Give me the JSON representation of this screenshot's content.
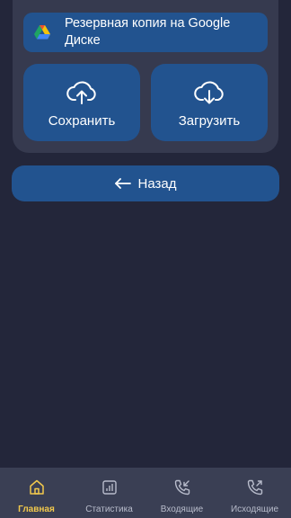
{
  "backup": {
    "drive_label": "Резервная копия на Google Диске",
    "save_label": "Сохранить",
    "load_label": "Загрузить"
  },
  "back_label": "Назад",
  "nav": {
    "items": [
      {
        "label": "Главная",
        "icon": "home-icon",
        "active": true
      },
      {
        "label": "Статистика",
        "icon": "stats-icon",
        "active": false
      },
      {
        "label": "Входящие",
        "icon": "incoming-call-icon",
        "active": false
      },
      {
        "label": "Исходящие",
        "icon": "outgoing-call-icon",
        "active": false
      }
    ]
  },
  "colors": {
    "background": "#23263a",
    "card": "#363a4f",
    "button": "#22538f",
    "nav_bar": "#3a3f54",
    "active": "#f2c94c"
  }
}
